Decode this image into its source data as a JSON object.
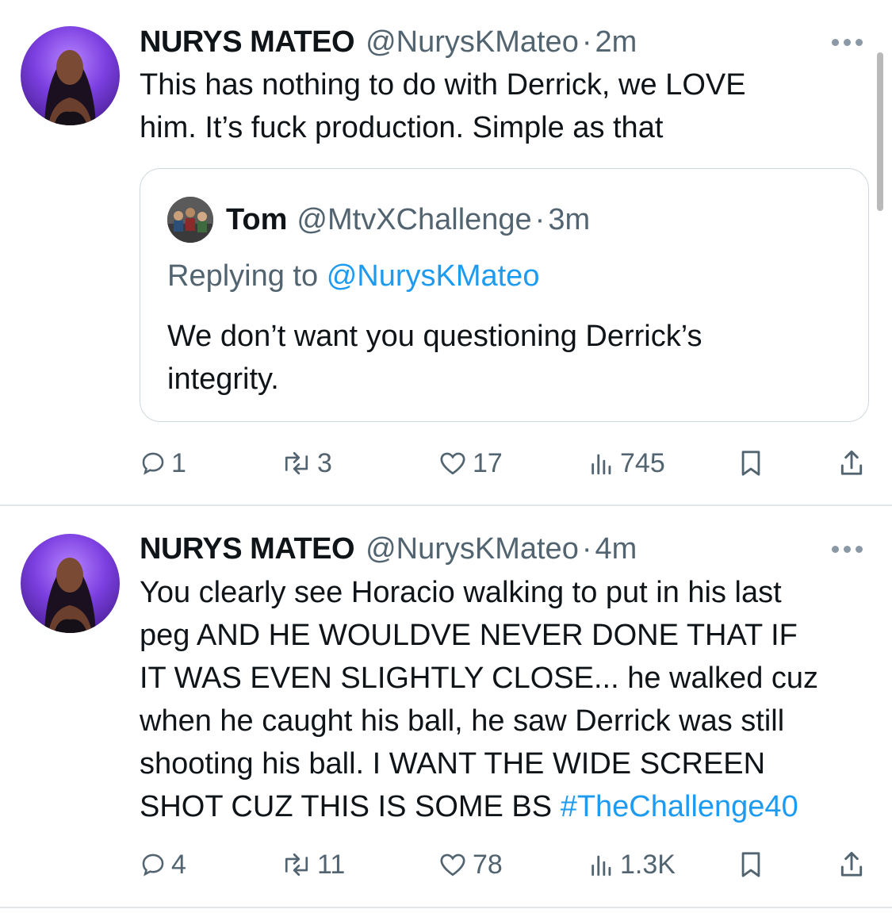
{
  "tweets": [
    {
      "author_name": "NURYS MATEO",
      "author_handle": "@NurysKMateo",
      "time": "2m",
      "text_lines": [
        "This has nothing to do with Derrick, we LOVE",
        "him. It’s fuck production. Simple as that"
      ],
      "quote": {
        "author_name": "Tom",
        "author_handle": "@MtvXChallenge",
        "time": "3m",
        "replying_label": "Replying to",
        "replying_handle": "@NurysKMateo",
        "text_lines": [
          "We don’t want you questioning Derrick’s",
          "integrity."
        ]
      },
      "stats": {
        "replies": "1",
        "reposts": "3",
        "likes": "17",
        "views": "745"
      }
    },
    {
      "author_name": "NURYS MATEO",
      "author_handle": "@NurysKMateo",
      "time": "4m",
      "text_lines": [
        "You clearly see Horacio walking to put in his last",
        "peg AND HE WOULDVE NEVER DONE THAT IF",
        "IT WAS EVEN SLIGHTLY CLOSE... he walked cuz",
        "when he caught his ball, he saw Derrick was still",
        "shooting his ball. I WANT THE WIDE SCREEN",
        "SHOT CUZ THIS IS SOME BS "
      ],
      "hashtag": "#TheChallenge40",
      "stats": {
        "replies": "4",
        "reposts": "11",
        "likes": "78",
        "views": "1.3K"
      }
    }
  ],
  "separator": "·",
  "icons": [
    "more-icon",
    "reply-icon",
    "repost-icon",
    "like-icon",
    "views-icon",
    "bookmark-icon",
    "share-icon"
  ],
  "colors": {
    "link": "#1d9bf0",
    "secondary": "#536471",
    "border": "#cfd9de",
    "avatar_bg": "#7b3fe0"
  }
}
